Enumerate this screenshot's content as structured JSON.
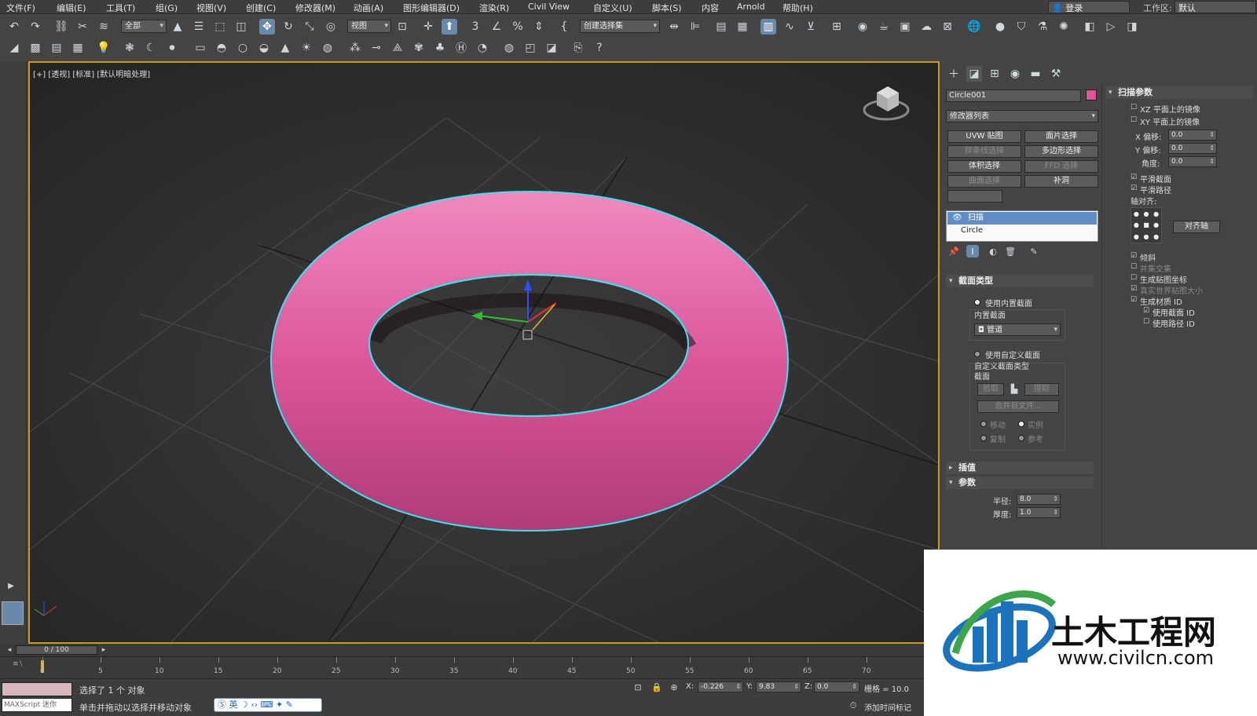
{
  "menu": [
    "文件(F)",
    "编辑(E)",
    "工具(T)",
    "组(G)",
    "视图(V)",
    "创建(C)",
    "修改器(M)",
    "动画(A)",
    "图形编辑器(D)",
    "渲染(R)",
    "Civil View",
    "自定义(U)",
    "脚本(S)",
    "内容",
    "Arnold",
    "帮助(H)"
  ],
  "login": "登录",
  "workspace_label": "工作区:",
  "workspace_value": "默认",
  "toolbar": {
    "filter_combo": "全部",
    "view_combo": "视图",
    "selection_set_combo": "创建选择集"
  },
  "viewport": {
    "label": "[+] [透视] [标准] [默认明暗处理]"
  },
  "command_panel": {
    "object_name": "Circle001",
    "object_color": "#e0559a",
    "modifier_list": "修改器列表",
    "modifier_buttons": [
      {
        "label": "UVW 贴图",
        "enabled": true
      },
      {
        "label": "面片选择",
        "enabled": true
      },
      {
        "label": "样条线选择",
        "enabled": false
      },
      {
        "label": "多边形选择",
        "enabled": true
      },
      {
        "label": "体积选择",
        "enabled": true
      },
      {
        "label": "FFD 选择",
        "enabled": false
      },
      {
        "label": "曲面选择",
        "enabled": false
      },
      {
        "label": "补洞",
        "enabled": true
      }
    ],
    "stack": [
      "扫描",
      "Circle"
    ],
    "section_type_title": "截面类型",
    "use_builtin_section": "使用内置截面",
    "builtin_section_label": "内置截面",
    "builtin_section_value": "管道",
    "use_custom_section": "使用自定义截面",
    "custom_section_type": "自定义截面类型",
    "section_label": "截面",
    "pick_btn": "拾取",
    "extract_btn": "提取",
    "merge_from_file": "合并自文件...",
    "move": "移动",
    "instance": "实例",
    "copy": "复制",
    "reference": "参考",
    "interpolation_title": "插值",
    "parameters_title": "参数",
    "radius_label": "半径:",
    "radius_value": "8.0",
    "thickness_label": "厚度:",
    "thickness_value": "1.0"
  },
  "sweep_params": {
    "title": "扫描参数",
    "mirror_xz": "XZ 平面上的镜像",
    "mirror_xy": "XY 平面上的镜像",
    "x_offset_label": "X 偏移:",
    "x_offset_value": "0.0",
    "y_offset_label": "Y 偏移:",
    "y_offset_value": "0.0",
    "angle_label": "角度:",
    "angle_value": "0.0",
    "smooth_section": "平滑截面",
    "smooth_path": "平滑路径",
    "pivot_align": "轴对齐:",
    "align_pivot_btn": "对齐轴",
    "banking": "倾斜",
    "union_intersections": "并集交集",
    "gen_mapping": "生成贴图坐标",
    "real_world_map": "真实世界贴图大小",
    "gen_material_ids": "生成材质 ID",
    "use_section_ids": "使用截面 ID",
    "use_path_ids": "使用路径 ID"
  },
  "timeline": {
    "frame_counter": "0 / 100",
    "ticks": [
      "0",
      "5",
      "10",
      "15",
      "20",
      "25",
      "30",
      "35",
      "40",
      "45",
      "50",
      "55",
      "60",
      "65",
      "70"
    ]
  },
  "status": {
    "maxscript": "MAXScript 迷你",
    "selected": "选择了 1 个 对象",
    "hint": "单击并拖动以选择并移动对象",
    "ime": "英",
    "x_label": "X:",
    "x_value": "-0.226",
    "y_label": "Y:",
    "y_value": "9.83",
    "z_label": "Z:",
    "z_value": "0.0",
    "grid": "栅格 = 10.0",
    "add_time_tag": "添加时间标记"
  },
  "watermark": {
    "title": "土木工程网",
    "url": "www.civilcn.com"
  }
}
